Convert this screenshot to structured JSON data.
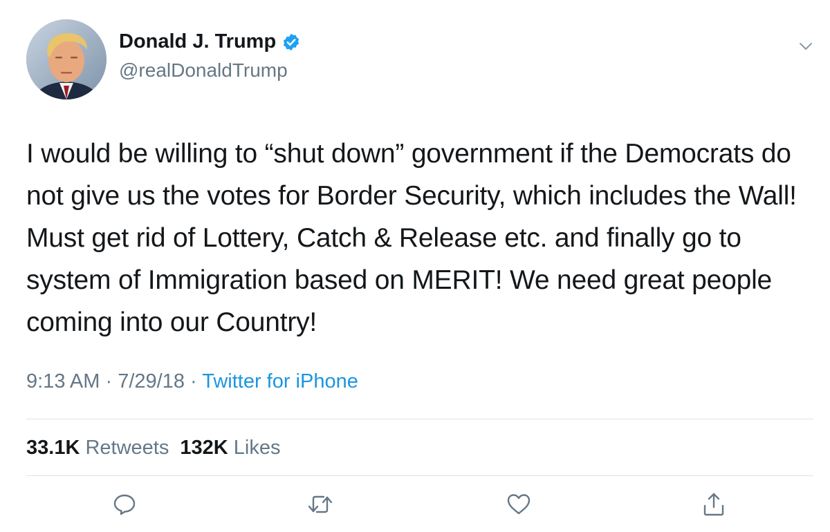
{
  "author": {
    "display_name": "Donald J. Trump",
    "handle": "@realDonaldTrump",
    "verified": true,
    "avatar_icon": "profile-photo"
  },
  "tweet": {
    "text": "I would be willing to “shut down” government if the Democrats do not give us the votes for Border Security, which includes the Wall! Must get rid of Lottery, Catch & Release etc. and finally go to system of Immigration based on MERIT! We need great people coming into our Country!",
    "time": "9:13 AM",
    "separator": " · ",
    "date": "7/29/18",
    "source": "Twitter for iPhone"
  },
  "stats": {
    "retweets_count": "33.1K",
    "retweets_label": "Retweets",
    "likes_count": "132K",
    "likes_label": "Likes"
  },
  "actions": [
    {
      "name": "reply",
      "icon": "speech-bubble-icon"
    },
    {
      "name": "retweet",
      "icon": "retweet-icon"
    },
    {
      "name": "like",
      "icon": "heart-icon"
    },
    {
      "name": "share",
      "icon": "share-icon"
    }
  ],
  "colors": {
    "text_primary": "#14171a",
    "text_secondary": "#657786",
    "link": "#1b95e0",
    "verified": "#1da1f2",
    "divider": "#dfe3e6"
  }
}
